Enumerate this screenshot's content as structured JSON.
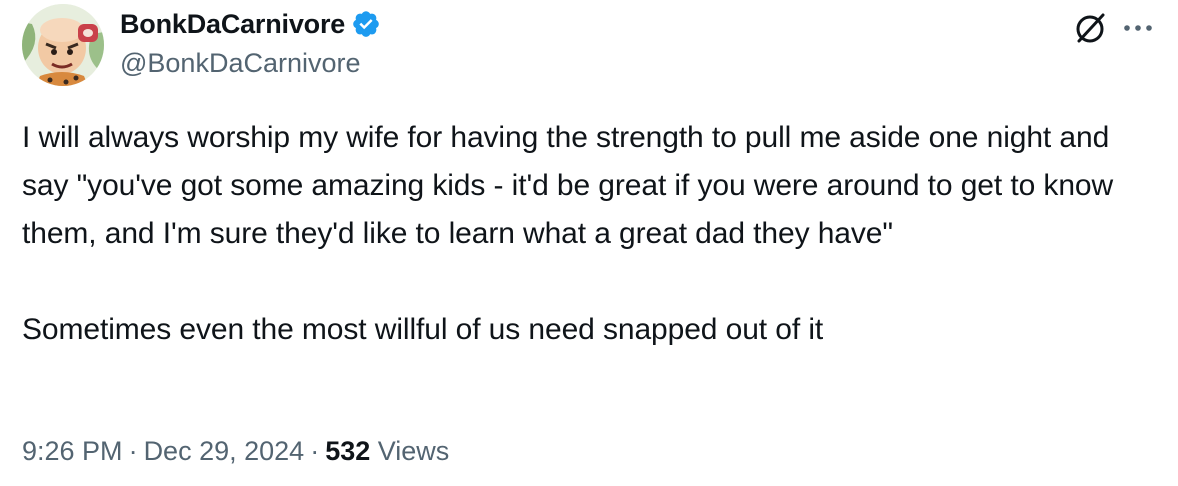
{
  "author": {
    "display_name": "BonkDaCarnivore",
    "handle": "@BonkDaCarnivore",
    "verified": true
  },
  "icons": {
    "verified": "verified-badge-icon",
    "grok": "grok-icon",
    "more": "more-options-icon"
  },
  "tweet": {
    "paragraph_1": "I will always worship my wife for having the strength to pull me aside one night and say \"you've got some amazing kids - it'd be great if you were around to get to know them, and I'm sure they'd like to learn what a great dad they have\"",
    "paragraph_2": "Sometimes even the most willful of us need snapped out of it"
  },
  "meta": {
    "time": "9:26 PM",
    "separator": "·",
    "date": "Dec 29, 2024",
    "views_count": "532",
    "views_label": "Views"
  },
  "colors": {
    "text": "#0f1419",
    "secondary": "#536471",
    "verified": "#1d9bf0"
  }
}
